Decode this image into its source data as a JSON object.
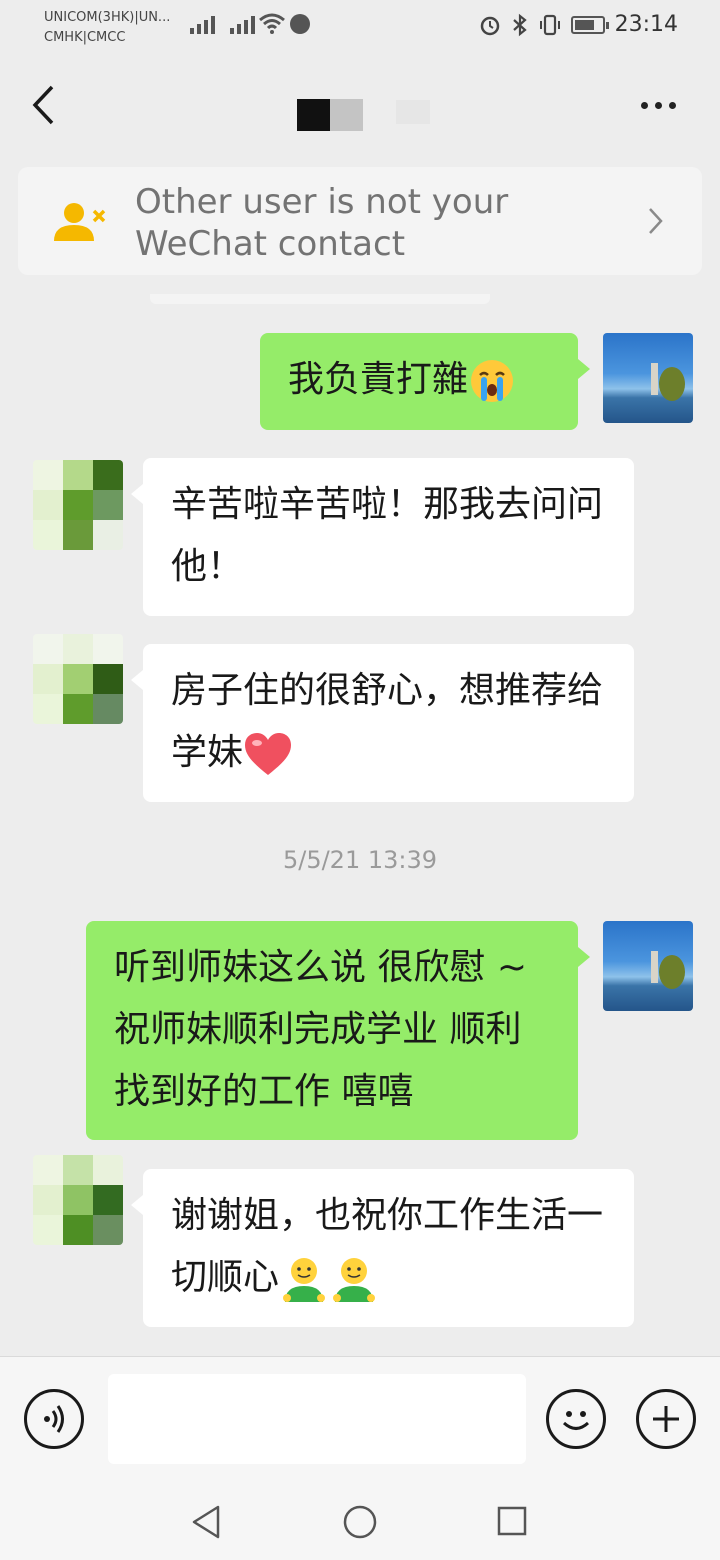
{
  "status_bar": {
    "carrier_line1": "UNICOM(3HK)|UN...",
    "carrier_line2": "CMHK|CMCC",
    "time": "23:14",
    "battery_level": 0.75
  },
  "header": {
    "back_icon": "chevron-left-icon",
    "more_icon": "more-dots-icon"
  },
  "notice": {
    "text": "Other user is not your WeChat contact",
    "icon": "user-remove-icon"
  },
  "messages": [
    {
      "side": "out",
      "text": "我负責打雜",
      "emoji": "crying-face"
    },
    {
      "side": "in",
      "text": "辛苦啦辛苦啦！那我去问问他！"
    },
    {
      "side": "in",
      "text": "房子住的很舒心，想推荐给学妹",
      "emoji": "heart"
    },
    {
      "side": "out",
      "text": "听到师妹这么说 很欣慰 ~ 祝师妹顺利完成学业 顺利找到好的工作 嘻嘻"
    },
    {
      "side": "in",
      "text": "谢谢姐，也祝你工作生活一切顺心",
      "emoji": "smile-person"
    }
  ],
  "timestamp": "5/5/21 13:39",
  "input_bar": {
    "voice_icon": "voice-icon",
    "input_value": "",
    "emoji_icon": "emoji-icon",
    "plus_icon": "plus-icon"
  },
  "colors": {
    "background": "#ededed",
    "outgoing_bubble": "#95ec69",
    "incoming_bubble": "#ffffff",
    "notice_icon": "#f5b800"
  }
}
